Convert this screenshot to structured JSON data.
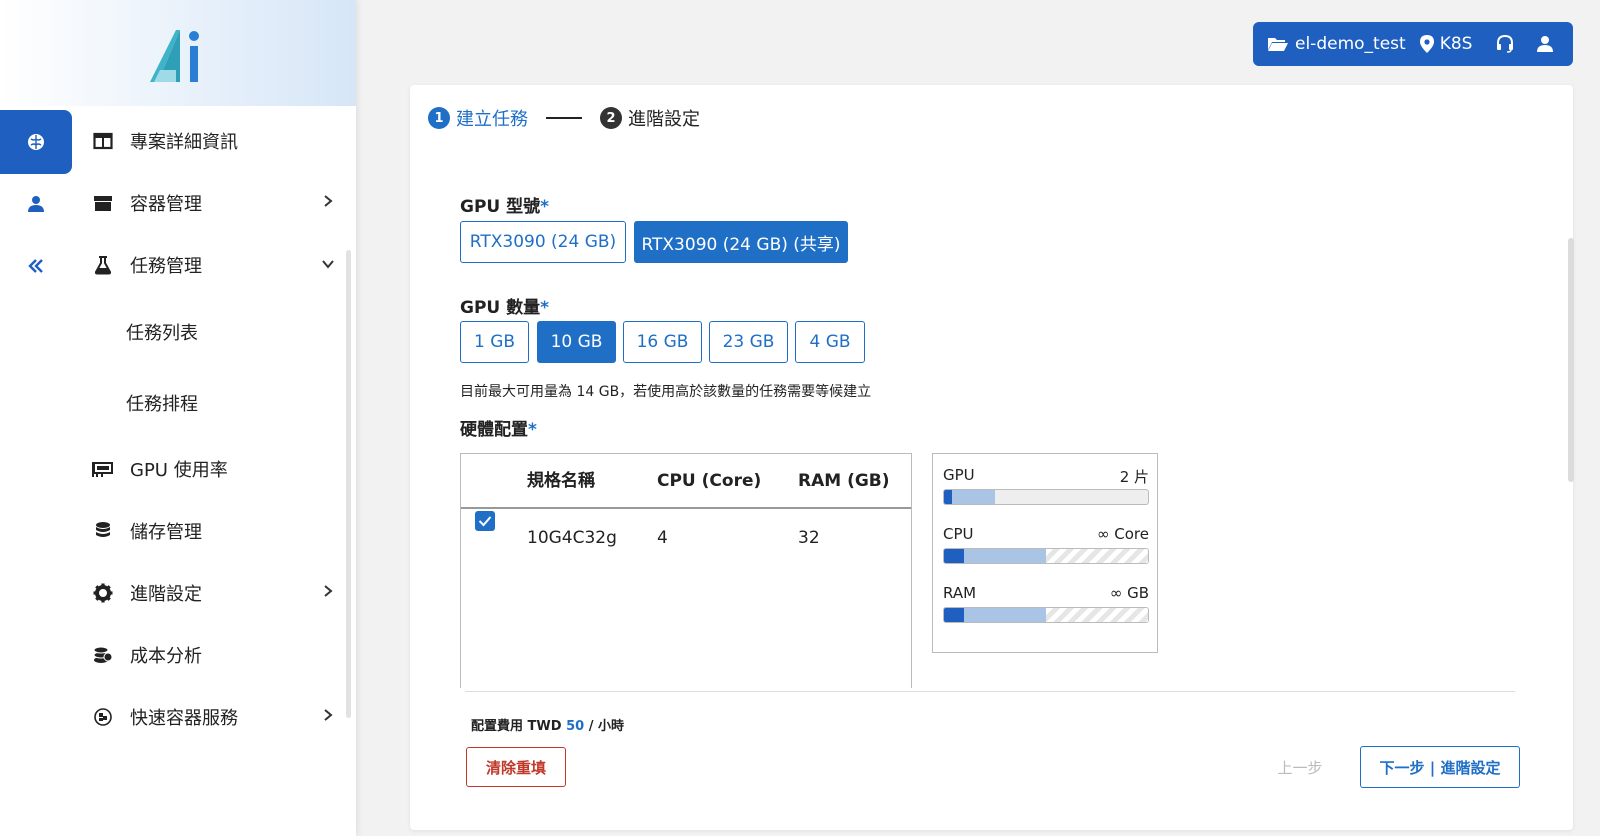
{
  "colors": {
    "primary": "#1f5fbf",
    "accent": "#1f6fc7",
    "danger": "#c0392b",
    "muted": "#bbbbbb"
  },
  "sidebar": {
    "rail": [
      {
        "icon": "brain-icon",
        "active": true
      },
      {
        "icon": "user-icon",
        "active": false
      },
      {
        "icon": "double-chevron-left-icon",
        "active": false
      }
    ],
    "items": [
      {
        "label": "專案詳細資訊",
        "icon": "columns-icon",
        "chevron": ""
      },
      {
        "label": "容器管理",
        "icon": "box-icon",
        "chevron": "›"
      },
      {
        "label": "任務管理",
        "icon": "flask-icon",
        "chevron": "⌄"
      },
      {
        "label": "任務列表",
        "icon": "",
        "chevron": ""
      },
      {
        "label": "任務排程",
        "icon": "",
        "chevron": ""
      },
      {
        "label": "GPU 使用率",
        "icon": "gpu-card-icon",
        "chevron": ""
      },
      {
        "label": "儲存管理",
        "icon": "database-icon",
        "chevron": ""
      },
      {
        "label": "進階設定",
        "icon": "gear-icon",
        "chevron": "›"
      },
      {
        "label": "成本分析",
        "icon": "coins-icon",
        "chevron": ""
      },
      {
        "label": "快速容器服務",
        "icon": "cubes-icon",
        "chevron": "›"
      }
    ]
  },
  "topbar": {
    "project": "el-demo_test",
    "cluster": "K8S"
  },
  "stepper": {
    "steps": [
      {
        "num": "1",
        "label": "建立任務"
      },
      {
        "num": "2",
        "label": "進階設定"
      }
    ]
  },
  "form": {
    "gpu_model": {
      "label": "GPU 型號",
      "required": "*",
      "options": [
        "RTX3090 (24 GB)",
        "RTX3090 (24 GB) (共享)"
      ],
      "selected": 1
    },
    "gpu_count": {
      "label": "GPU 數量",
      "required": "*",
      "options": [
        "1 GB",
        "10 GB",
        "16 GB",
        "23 GB",
        "4 GB"
      ],
      "selected": 1,
      "hint": "目前最大可用量為 14 GB，若使用高於該數量的任務需要等候建立"
    },
    "hardware": {
      "label": "硬體配置",
      "required": "*",
      "columns": [
        "規格名稱",
        "CPU (Core)",
        "RAM (GB)"
      ],
      "rows": [
        {
          "name": "10G4C32g",
          "cpu": "4",
          "ram": "32",
          "checked": true
        }
      ]
    }
  },
  "usage": [
    {
      "name": "GPU",
      "value": "2 片",
      "used": 0.04,
      "requested": 0.25,
      "hatched": false
    },
    {
      "name": "CPU",
      "value": "∞ Core",
      "used": 0.1,
      "requested": 0.5,
      "hatched": true
    },
    {
      "name": "RAM",
      "value": "∞ GB",
      "used": 0.1,
      "requested": 0.5,
      "hatched": true
    }
  ],
  "footer": {
    "cost_prefix": "配置費用 TWD",
    "cost_amount": "50",
    "cost_suffix": "/ 小時",
    "clear": "清除重填",
    "prev": "上一步",
    "next": "下一步 | 進階設定"
  }
}
